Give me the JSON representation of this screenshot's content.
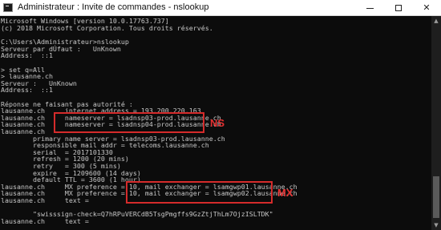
{
  "window": {
    "title": "Administrateur : Invite de commandes - nslookup",
    "app_icon": "cmd-icon",
    "controls": [
      "minimize-icon",
      "maximize-icon",
      "close-icon"
    ]
  },
  "console": {
    "lines": [
      "Microsoft Windows [version 10.0.17763.737]",
      "(c) 2018 Microsoft Corporation. Tous droits réservés.",
      "",
      "C:\\Users\\Administrateur>nslookup",
      "Serveur par dÚfaut :   UnKnown",
      "Address:  ::1",
      "",
      "> set q=All",
      "> lausanne.ch",
      "Serveur :   UnKnown",
      "Address:  ::1",
      "",
      "Réponse ne faisant pas autorité :",
      "lausanne.ch     internet address = 193.200.220.163",
      "lausanne.ch     nameserver = lsadnsp03-prod.lausanne.ch",
      "lausanne.ch     nameserver = lsadnsp04-prod.lausanne.ch",
      "lausanne.ch",
      "        primary name server = lsadnsp03-prod.lausanne.ch",
      "        responsible mail addr = telecoms.lausanne.ch",
      "        serial  = 2017101330",
      "        refresh = 1200 (20 mins)",
      "        retry   = 300 (5 mins)",
      "        expire  = 1209600 (14 days)",
      "        default TTL = 3600 (1 hour)",
      "lausanne.ch     MX preference = 10, mail exchanger = lsamgwp01.lausanne.ch",
      "lausanne.ch     MX preference = 10, mail exchanger = lsamgwp02.lausanne.ch",
      "lausanne.ch     text =",
      "",
      "        \"swisssign-check=Q7hRPuVERCdB5TsgPmgffs9GzZtjThLm7OjzISLTDK\"",
      "lausanne.ch     text ="
    ]
  },
  "annotations": {
    "ns_label": "NS",
    "mx_label": "MX",
    "highlight_color": "#d52b2b"
  }
}
